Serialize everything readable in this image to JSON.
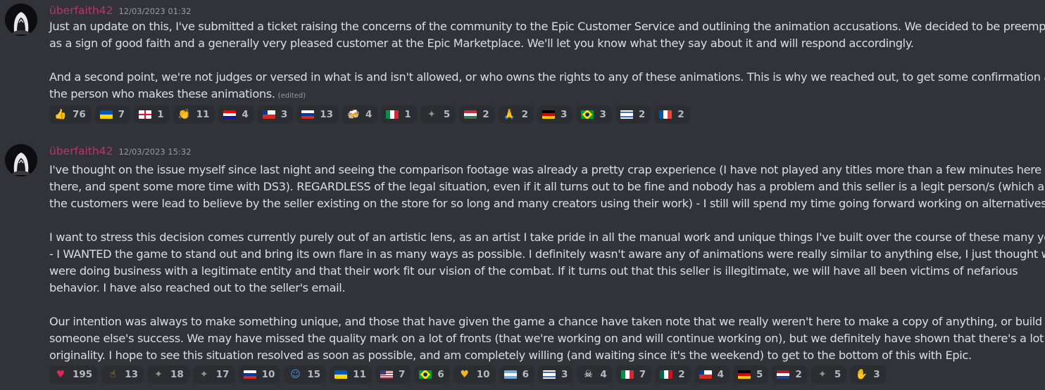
{
  "messages": [
    {
      "username": "überfaith42",
      "timestamp": "12/03/2023 01:32",
      "lines": [
        "Just an update on this, I've submitted a ticket raising the concerns of the community to the Epic Customer Service and outlining the animation accusations. We decided to be preemptive",
        "as a sign of good faith and a generally very pleased customer at the Epic Marketplace. We'll let you know what they say about it and will respond accordingly.",
        "",
        "And a second point, we're not judges or versed in what is and isn't allowed, or who owns the rights to any of these animations. This is why we reached out, to get some confirmation about",
        "the person who makes these animations."
      ],
      "edited": "(edited)",
      "reactions": [
        {
          "icon": "thumbs-up-icon",
          "count": "76"
        },
        {
          "icon": "flag-ukraine-icon",
          "count": "7"
        },
        {
          "icon": "flag-georgia-icon",
          "count": "1"
        },
        {
          "icon": "clapping-hands-icon",
          "count": "11"
        },
        {
          "icon": "flag-croatia-icon",
          "count": "4"
        },
        {
          "icon": "flag-chile-icon",
          "count": "3"
        },
        {
          "icon": "flag-russia-icon",
          "count": "13"
        },
        {
          "icon": "beer-mugs-icon",
          "count": "4"
        },
        {
          "icon": "flag-italy-icon",
          "count": "1"
        },
        {
          "icon": "custom-emoji-icon",
          "count": "5"
        },
        {
          "icon": "flag-hungary-icon",
          "count": "2"
        },
        {
          "icon": "folded-hands-icon",
          "count": "2"
        },
        {
          "icon": "flag-germany-icon",
          "count": "3"
        },
        {
          "icon": "flag-brazil-icon",
          "count": "3"
        },
        {
          "icon": "flag-israel-icon",
          "count": "2"
        },
        {
          "icon": "flag-france-icon",
          "count": "2"
        }
      ]
    },
    {
      "username": "überfaith42",
      "timestamp": "12/03/2023 15:32",
      "lines": [
        "I've thought on the issue myself since last night and seeing the comparison footage was already a pretty crap experience (I have not played any titles more than a few minutes here and",
        "there, and spent some more time with DS3). REGARDLESS of the legal situation, even if it all turns out to be fine and nobody has a problem and this seller is a legit person/s (which all of",
        "the customers were lead to believe by the seller existing on the store for so long and many creators using their work) - I still will spend my time going forward working on alternatives.",
        "",
        "I want to stress this decision comes currently purely out of an artistic lens, as an artist I take pride in all the manual work and unique things I've built over the course of these many years",
        "- I WANTED the game to stand out and bring its own flare in as many ways as possible. I definitely wasn't aware any of animations were really similar to anything else, I just thought we",
        "were doing business with a legitimate entity and that their work fit our vision of the combat. If it turns out that this seller is illegitimate, we will have all been victims of nefarious",
        "behavior. I have also reached out to the seller's email.",
        "",
        "Our intention was always to make something unique, and those that have given the game a chance have taken note that we really weren't here to make a copy of anything, or build off of",
        "someone else's success. We may have missed the quality mark on a lot of fronts (that we're working on and will continue working on), but we definitely have shown that there's a lot of",
        "originality. I hope to see this situation resolved as soon as possible, and am completely willing (and waiting since it's the weekend) to get to the bottom of this with Epic."
      ],
      "edited": "",
      "reactions": [
        {
          "icon": "red-heart-icon",
          "count": "195"
        },
        {
          "icon": "pointing-hand-icon",
          "count": "13"
        },
        {
          "icon": "custom-emoji-icon",
          "count": "18"
        },
        {
          "icon": "custom-emoji-icon",
          "count": "17"
        },
        {
          "icon": "flag-russia-icon",
          "count": "10"
        },
        {
          "icon": "people-hugging-icon",
          "count": "15"
        },
        {
          "icon": "flag-ukraine-icon",
          "count": "11"
        },
        {
          "icon": "flag-usa-icon",
          "count": "7"
        },
        {
          "icon": "flag-brazil-icon",
          "count": "6"
        },
        {
          "icon": "heart-hands-icon",
          "count": "10"
        },
        {
          "icon": "flag-argentina-icon",
          "count": "6"
        },
        {
          "icon": "flag-israel-icon",
          "count": "3"
        },
        {
          "icon": "ghost-icon",
          "count": "4"
        },
        {
          "icon": "flag-italy-icon",
          "count": "7"
        },
        {
          "icon": "flag-mexico-icon",
          "count": "2"
        },
        {
          "icon": "flag-chile-icon",
          "count": "4"
        },
        {
          "icon": "flag-germany-icon",
          "count": "5"
        },
        {
          "icon": "flag-netherlands-icon",
          "count": "2"
        },
        {
          "icon": "custom-emoji-icon",
          "count": "5"
        },
        {
          "icon": "raising-hands-icon",
          "count": "3"
        }
      ]
    }
  ]
}
